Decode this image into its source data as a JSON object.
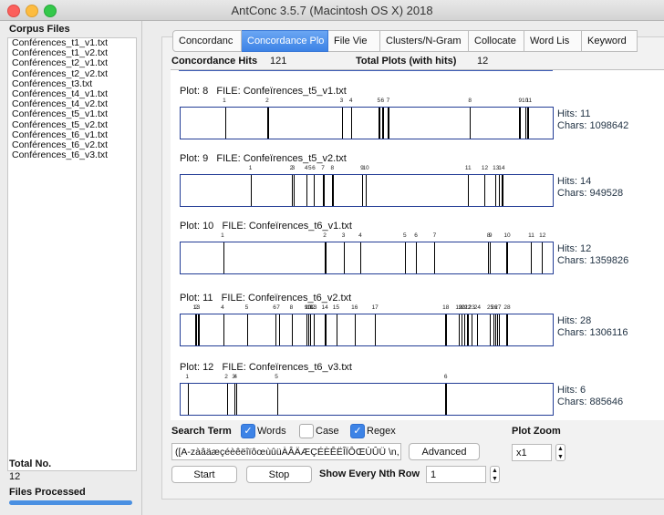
{
  "window": {
    "title": "AntConc 3.5.7 (Macintosh OS X) 2018"
  },
  "sidebar": {
    "header": "Corpus Files",
    "files": [
      "Conférences_t1_v1.txt",
      "Conférences_t1_v2.txt",
      "Conférences_t2_v1.txt",
      "Conférences_t2_v2.txt",
      "Conférences_t3.txt",
      "Conférences_t4_v1.txt",
      "Conférences_t4_v2.txt",
      "Conférences_t5_v1.txt",
      "Conférences_t5_v2.txt",
      "Conférences_t6_v1.txt",
      "Conférences_t6_v2.txt",
      "Conférences_t6_v3.txt"
    ],
    "total_label": "Total No.",
    "total_value": "12",
    "processed_label": "Files Processed",
    "progress": 1.0
  },
  "tabs": [
    "Concordanc",
    "Concordance Plo",
    "File Vie",
    "Clusters/N-Gram",
    "Collocate",
    "Word Lis",
    "Keyword"
  ],
  "active_tab": 1,
  "summary": {
    "hits_label": "Concordance Hits",
    "hits_value": "121",
    "plots_label": "Total Plots (with hits)",
    "plots_value": "12"
  },
  "plots": [
    {
      "plot_label": "Plot: 8",
      "file": "FILE: Confeïrences_t5_v1.txt",
      "hits": "Hits: 11",
      "chars": "Chars: 1098642",
      "hit_positions": [
        0.12,
        0.235,
        0.435,
        0.46,
        0.535,
        0.545,
        0.56,
        0.78,
        0.915,
        0.93,
        0.937
      ],
      "tick_labels": [
        {
          "t": "1",
          "p": 0.12
        },
        {
          "t": "2",
          "p": 0.235
        },
        {
          "t": "3",
          "p": 0.435
        },
        {
          "t": "4",
          "p": 0.46
        },
        {
          "t": "5",
          "p": 0.535
        },
        {
          "t": "6",
          "p": 0.545
        },
        {
          "t": "7",
          "p": 0.56
        },
        {
          "t": "8",
          "p": 0.78
        },
        {
          "t": "9",
          "p": 0.915
        },
        {
          "t": "10",
          "p": 0.928
        },
        {
          "t": "11",
          "p": 0.938
        }
      ]
    },
    {
      "plot_label": "Plot: 9",
      "file": "FILE: Confeïrences_t5_v2.txt",
      "hits": "Hits: 14",
      "chars": "Chars: 949528",
      "hit_positions": [
        0.19,
        0.3,
        0.305,
        0.34,
        0.36,
        0.385,
        0.41,
        0.49,
        0.5,
        0.775,
        0.82,
        0.85,
        0.86,
        0.868
      ],
      "tick_labels": [
        {
          "t": "1",
          "p": 0.19
        },
        {
          "t": "2",
          "p": 0.3
        },
        {
          "t": "3",
          "p": 0.305
        },
        {
          "t": "4",
          "p": 0.34
        },
        {
          "t": "5",
          "p": 0.35
        },
        {
          "t": "6",
          "p": 0.36
        },
        {
          "t": "7",
          "p": 0.385
        },
        {
          "t": "8",
          "p": 0.41
        },
        {
          "t": "9",
          "p": 0.49
        },
        {
          "t": "10",
          "p": 0.5
        },
        {
          "t": "11",
          "p": 0.775
        },
        {
          "t": "12",
          "p": 0.82
        },
        {
          "t": "13",
          "p": 0.85
        },
        {
          "t": "14",
          "p": 0.865
        }
      ]
    },
    {
      "plot_label": "Plot: 10",
      "file": "FILE: Confeïrences_t6_v1.txt",
      "hits": "Hits: 12",
      "chars": "Chars: 1359826",
      "hit_positions": [
        0.115,
        0.39,
        0.44,
        0.485,
        0.605,
        0.635,
        0.685,
        0.83,
        0.835,
        0.88,
        0.945,
        0.975
      ],
      "tick_labels": [
        {
          "t": "1",
          "p": 0.115
        },
        {
          "t": "2",
          "p": 0.39
        },
        {
          "t": "3",
          "p": 0.44
        },
        {
          "t": "4",
          "p": 0.485
        },
        {
          "t": "5",
          "p": 0.605
        },
        {
          "t": "6",
          "p": 0.635
        },
        {
          "t": "7",
          "p": 0.685
        },
        {
          "t": "8",
          "p": 0.83
        },
        {
          "t": "9",
          "p": 0.835
        },
        {
          "t": "10",
          "p": 0.88
        },
        {
          "t": "11",
          "p": 0.945
        },
        {
          "t": "12",
          "p": 0.975
        }
      ]
    },
    {
      "plot_label": "Plot: 11",
      "file": "FILE: Confeïrences_t6_v2.txt",
      "hits": "Hits: 28",
      "chars": "Chars: 1306116",
      "hit_positions": [
        0.04,
        0.048,
        0.115,
        0.18,
        0.255,
        0.265,
        0.3,
        0.34,
        0.345,
        0.35,
        0.36,
        0.39,
        0.42,
        0.47,
        0.525,
        0.715,
        0.75,
        0.758,
        0.766,
        0.774,
        0.785,
        0.8,
        0.835,
        0.845,
        0.85,
        0.855,
        0.86,
        0.88
      ],
      "tick_labels": [
        {
          "t": "1",
          "p": 0.04
        },
        {
          "t": "2",
          "p": 0.045
        },
        {
          "t": "3",
          "p": 0.05
        },
        {
          "t": "4",
          "p": 0.115
        },
        {
          "t": "5",
          "p": 0.18
        },
        {
          "t": "6",
          "p": 0.255
        },
        {
          "t": "7",
          "p": 0.265
        },
        {
          "t": "8",
          "p": 0.3
        },
        {
          "t": "9",
          "p": 0.34
        },
        {
          "t": "10",
          "p": 0.345
        },
        {
          "t": "11",
          "p": 0.35
        },
        {
          "t": "12",
          "p": 0.355
        },
        {
          "t": "13",
          "p": 0.36
        },
        {
          "t": "14",
          "p": 0.39
        },
        {
          "t": "15",
          "p": 0.42
        },
        {
          "t": "16",
          "p": 0.47
        },
        {
          "t": "17",
          "p": 0.525
        },
        {
          "t": "18",
          "p": 0.715
        },
        {
          "t": "19",
          "p": 0.75
        },
        {
          "t": "20",
          "p": 0.758
        },
        {
          "t": "21",
          "p": 0.766
        },
        {
          "t": "22",
          "p": 0.774
        },
        {
          "t": "23",
          "p": 0.785
        },
        {
          "t": "24",
          "p": 0.8
        },
        {
          "t": "25",
          "p": 0.835
        },
        {
          "t": "26",
          "p": 0.845
        },
        {
          "t": "27",
          "p": 0.855
        },
        {
          "t": "28",
          "p": 0.88
        }
      ]
    },
    {
      "plot_label": "Plot: 12",
      "file": "FILE: Confeïrences_t6_v3.txt",
      "hits": "Hits: 6",
      "chars": "Chars: 885646",
      "hit_positions": [
        0.02,
        0.125,
        0.145,
        0.15,
        0.26,
        0.715
      ],
      "tick_labels": [
        {
          "t": "1",
          "p": 0.02
        },
        {
          "t": "2",
          "p": 0.125
        },
        {
          "t": "3",
          "p": 0.145
        },
        {
          "t": "4",
          "p": 0.15
        },
        {
          "t": "5",
          "p": 0.26
        },
        {
          "t": "6",
          "p": 0.715
        }
      ]
    }
  ],
  "controls": {
    "search_term_label": "Search Term",
    "words_label": "Words",
    "words_checked": true,
    "case_label": "Case",
    "case_checked": false,
    "regex_label": "Regex",
    "regex_checked": true,
    "plot_zoom_label": "Plot Zoom",
    "search_value": "([A-zàâäæçéèêëîïôœùûüÀÂÄÆÇÉÈÊËÎÏÔŒÙÛÜ \\n,",
    "advanced_label": "Advanced",
    "zoom_value": "x1",
    "start_label": "Start",
    "stop_label": "Stop",
    "nth_label": "Show Every Nth Row",
    "nth_value": "1"
  }
}
